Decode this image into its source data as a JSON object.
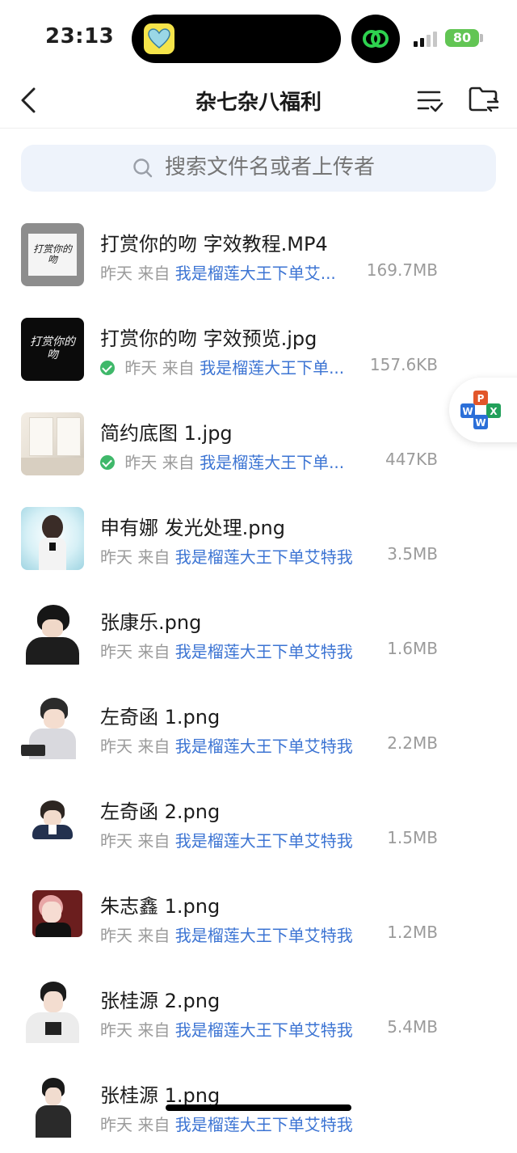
{
  "status_bar": {
    "time": "23:13",
    "battery": "80"
  },
  "nav": {
    "title": "杂七杂八福利"
  },
  "search": {
    "placeholder": "搜索文件名或者上传者"
  },
  "files": [
    {
      "name": "打赏你的吻 字效教程.MP4",
      "date": "昨天",
      "from_label": "来自",
      "uploader": "我是榴莲大王下单艾...",
      "size": "169.7MB",
      "downloaded": false,
      "thumb_text": "打赏你的吻"
    },
    {
      "name": "打赏你的吻 字效预览.jpg",
      "date": "昨天",
      "from_label": "来自",
      "uploader": "我是榴莲大王下单...",
      "size": "157.6KB",
      "downloaded": true,
      "thumb_text": "打赏你的吻"
    },
    {
      "name": "简约底图 1.jpg",
      "date": "昨天",
      "from_label": "来自",
      "uploader": "我是榴莲大王下单...",
      "size": "447KB",
      "downloaded": true
    },
    {
      "name": "申有娜 发光处理.png",
      "date": "昨天",
      "from_label": "来自",
      "uploader": "我是榴莲大王下单艾特我",
      "size": "3.5MB",
      "downloaded": false
    },
    {
      "name": "张康乐.png",
      "date": "昨天",
      "from_label": "来自",
      "uploader": "我是榴莲大王下单艾特我",
      "size": "1.6MB",
      "downloaded": false
    },
    {
      "name": "左奇函 1.png",
      "date": "昨天",
      "from_label": "来自",
      "uploader": "我是榴莲大王下单艾特我",
      "size": "2.2MB",
      "downloaded": false
    },
    {
      "name": "左奇函 2.png",
      "date": "昨天",
      "from_label": "来自",
      "uploader": "我是榴莲大王下单艾特我",
      "size": "1.5MB",
      "downloaded": false
    },
    {
      "name": "朱志鑫 1.png",
      "date": "昨天",
      "from_label": "来自",
      "uploader": "我是榴莲大王下单艾特我",
      "size": "1.2MB",
      "downloaded": false
    },
    {
      "name": "张桂源 2.png",
      "date": "昨天",
      "from_label": "来自",
      "uploader": "我是榴莲大王下单艾特我",
      "size": "5.4MB",
      "downloaded": false
    },
    {
      "name": "张桂源 1.png",
      "date": "昨天",
      "from_label": "来自",
      "uploader": "我是榴莲大王下单艾特我",
      "size": "",
      "downloaded": false
    }
  ],
  "icons": {
    "back": "chevron-left-icon",
    "sort": "sort-list-icon",
    "folder": "folder-transfer-icon",
    "search": "search-icon",
    "office": "office-apps-icon"
  },
  "colors": {
    "accent": "#3c74d3",
    "check": "#3fb86a",
    "battery": "#62c554",
    "search_bg": "#eef3fb"
  }
}
